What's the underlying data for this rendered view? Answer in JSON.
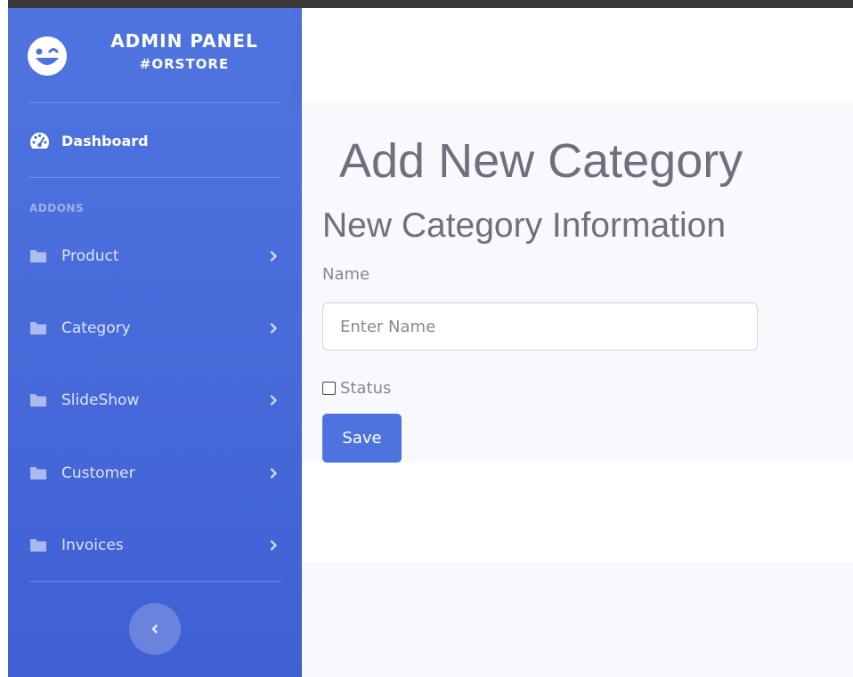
{
  "brand": {
    "title": "ADMIN PANEL",
    "subtitle": "#ORSTORE"
  },
  "sidebar": {
    "dashboard_label": "Dashboard",
    "heading": "ADDONS",
    "items": [
      {
        "label": "Product",
        "icon": "folder-icon"
      },
      {
        "label": "Category",
        "icon": "folder-icon"
      },
      {
        "label": "SlideShow",
        "icon": "folder-icon"
      },
      {
        "label": "Customer",
        "icon": "folder-icon"
      },
      {
        "label": "Invoices",
        "icon": "folder-icon"
      }
    ],
    "toggle_icon": "chevron-left-icon"
  },
  "main": {
    "page_title": "Add New Category",
    "section_title": "New Category Information",
    "form": {
      "name_label": "Name",
      "name_placeholder": "Enter Name",
      "name_value": "",
      "status_label": "Status",
      "status_checked": false,
      "save_label": "Save"
    }
  },
  "colors": {
    "primary": "#4e73df",
    "sidebar_gradient_end": "#3f60d3",
    "content_bg": "#f8f9fc",
    "heading_text": "#6e707e",
    "muted_text": "#858796"
  }
}
